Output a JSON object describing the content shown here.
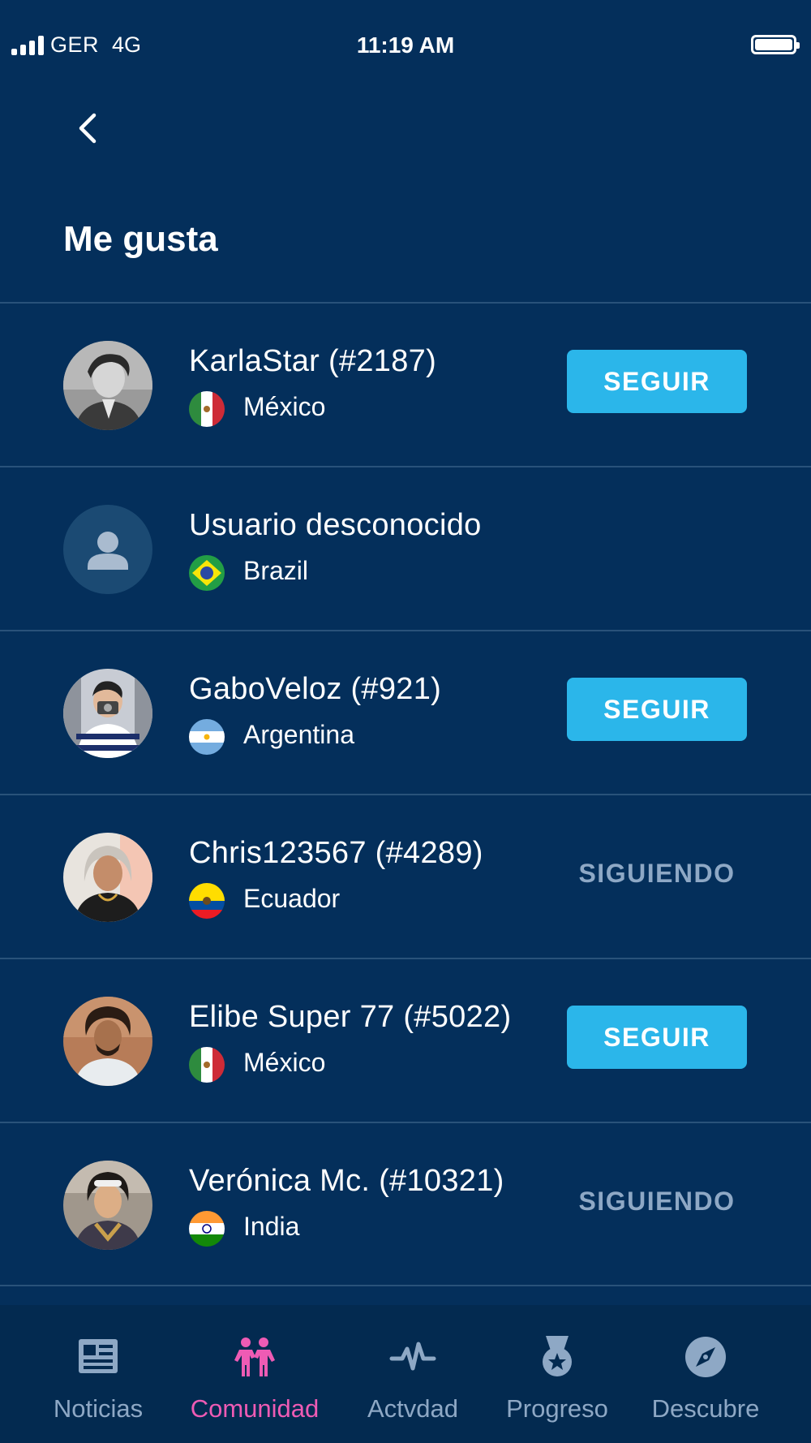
{
  "status_bar": {
    "carrier": "GER",
    "network": "4G",
    "time": "11:19 AM"
  },
  "page": {
    "title": "Me gusta"
  },
  "colors": {
    "background": "#042f5b",
    "accent": "#2bb6ea",
    "active_tab": "#ee5bb4",
    "muted_text": "#8ea8c5"
  },
  "users": [
    {
      "name": "KarlaStar (#2187)",
      "country": "México",
      "flag": "mexico-flag-icon",
      "action": "SEGUIR"
    },
    {
      "name": "Usuario desconocido",
      "country": "Brazil",
      "flag": "brazil-flag-icon",
      "action": ""
    },
    {
      "name": "GaboVeloz (#921)",
      "country": "Argentina",
      "flag": "argentina-flag-icon",
      "action": "SEGUIR"
    },
    {
      "name": "Chris123567 (#4289)",
      "country": "Ecuador",
      "flag": "ecuador-flag-icon",
      "action": "SIGUIENDO"
    },
    {
      "name": "Elibe Super 77 (#5022)",
      "country": "México",
      "flag": "mexico-flag-icon",
      "action": "SEGUIR"
    },
    {
      "name": "Verónica Mc. (#10321)",
      "country": "India",
      "flag": "india-flag-icon",
      "action": "SIGUIENDO"
    }
  ],
  "tabs": [
    {
      "label": "Noticias",
      "icon": "newspaper-icon",
      "active": false
    },
    {
      "label": "Comunidad",
      "icon": "community-icon",
      "active": true
    },
    {
      "label": "Actvdad",
      "icon": "activity-pulse-icon",
      "active": false
    },
    {
      "label": "Progreso",
      "icon": "medal-icon",
      "active": false
    },
    {
      "label": "Descubre",
      "icon": "compass-icon",
      "active": false
    }
  ]
}
